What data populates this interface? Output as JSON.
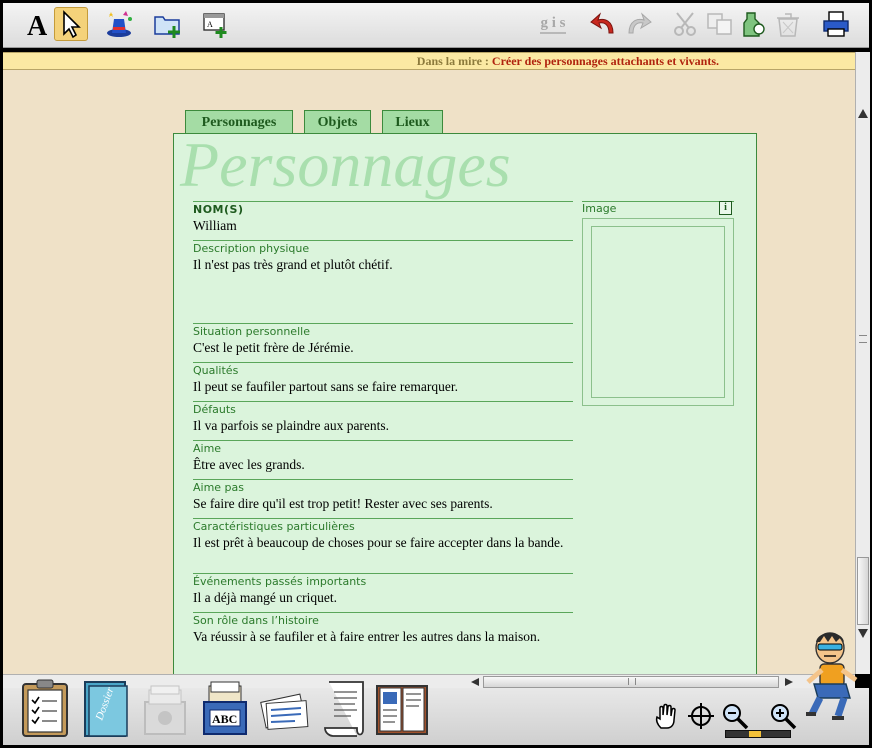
{
  "toolbar": {
    "left_tools": [
      "text-tool",
      "selection-tool",
      "magic-hat-tool",
      "new-folder-tool",
      "new-page-tool"
    ],
    "format_label": "g i s",
    "right_tools": [
      "undo",
      "redo",
      "cut",
      "copy",
      "paste",
      "delete",
      "print"
    ]
  },
  "mire": {
    "label": "Dans la mire :",
    "value": "Créer des personnages attachants et vivants."
  },
  "tabs": [
    {
      "label": "Personnages",
      "selected": true
    },
    {
      "label": "Objets",
      "selected": false
    },
    {
      "label": "Lieux",
      "selected": false
    }
  ],
  "card": {
    "title": "Personnages",
    "fields": [
      {
        "label": "NOM(S)",
        "value": "William"
      },
      {
        "label": "Description physique",
        "value": "Il n'est pas très grand et plutôt chétif."
      },
      {
        "label": "Situation personnelle",
        "value": "C'est le petit frère de Jérémie."
      },
      {
        "label": "Qualités",
        "value": "Il peut se faufiler partout sans se faire remarquer."
      },
      {
        "label": "Défauts",
        "value": "Il va parfois se plaindre aux parents."
      },
      {
        "label": "Aime",
        "value": "Être avec les grands."
      },
      {
        "label": "Aime pas",
        "value": "Se faire dire qu'il est trop petit! Rester avec ses parents."
      },
      {
        "label": "Caractéristiques particulières",
        "value": "Il est prêt à beaucoup de choses pour se faire accepter dans la bande."
      },
      {
        "label": "Événements passés importants",
        "value": "Il a déjà mangé un criquet."
      },
      {
        "label": "Son rôle dans l’histoire",
        "value": "Va réussir à se faufiler et à faire entrer les autres dans la maison."
      }
    ],
    "image": {
      "label": "Image",
      "info": "i"
    }
  },
  "bottom": {
    "items": [
      "clipboard-notes",
      "binder-folder",
      "card-box-faded",
      "abc-card-box",
      "cards-stack",
      "scroll-parchment",
      "open-book"
    ],
    "tools": [
      "hand-tool",
      "crosshair-tool",
      "zoom-out-tool",
      "zoom-in-tool"
    ],
    "zoom_level": 0.45
  },
  "colors": {
    "accent": "#3c8a3c",
    "card_bg": "#dbf4dc",
    "workspace": "#efe1c7",
    "mire_value": "#b0230e"
  }
}
